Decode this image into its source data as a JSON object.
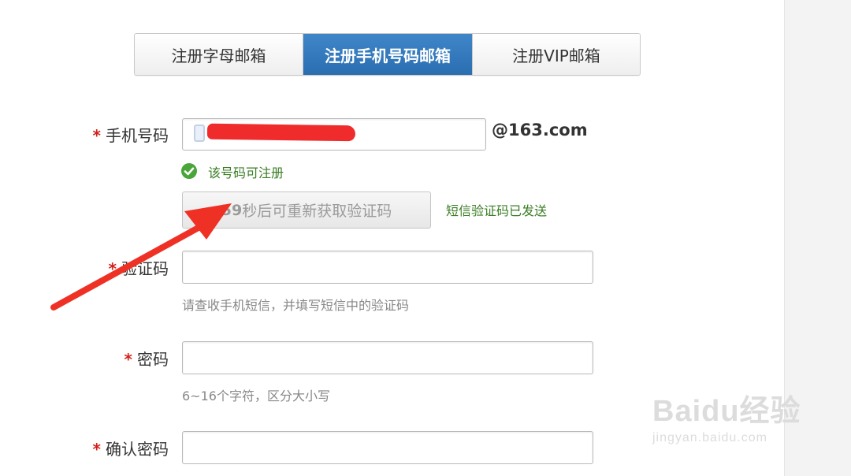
{
  "tabs": [
    {
      "label": "注册字母邮箱",
      "active": false
    },
    {
      "label": "注册手机号码邮箱",
      "active": true
    },
    {
      "label": "注册VIP邮箱",
      "active": false
    }
  ],
  "form": {
    "required_mark": "*",
    "phone": {
      "label": "手机号码",
      "value": "",
      "domain_suffix": "@163.com",
      "status": "该号码可注册"
    },
    "sms_code_button": {
      "countdown": "59",
      "label": "秒后可重新获取验证码"
    },
    "sms_sent_text": "短信验证码已发送",
    "verify_code": {
      "label": "验证码",
      "value": "",
      "hint": "请查收手机短信，并填写短信中的验证码"
    },
    "password": {
      "label": "密码",
      "value": "",
      "hint": "6~16个字符，区分大小写"
    },
    "confirm_password": {
      "label": "确认密码",
      "value": ""
    }
  },
  "colors": {
    "accent": "#2f76b8",
    "required": "#d0201b",
    "success": "#3a7d24",
    "annotation_arrow": "#ee3124"
  },
  "watermark": {
    "logo": "Baidu经验",
    "url": "jingyan.baidu.com"
  }
}
